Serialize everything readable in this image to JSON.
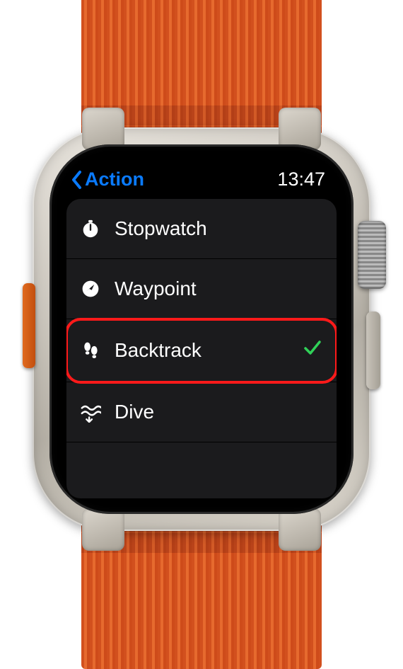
{
  "header": {
    "back_label": "Action",
    "time": "13:47"
  },
  "items": [
    {
      "id": "stopwatch",
      "label": "Stopwatch",
      "icon": "stopwatch-icon",
      "selected": false
    },
    {
      "id": "waypoint",
      "label": "Waypoint",
      "icon": "location-icon",
      "selected": false
    },
    {
      "id": "backtrack",
      "label": "Backtrack",
      "icon": "footprints-icon",
      "selected": true,
      "highlighted": true
    },
    {
      "id": "dive",
      "label": "Dive",
      "icon": "dive-icon",
      "selected": false
    }
  ],
  "colors": {
    "accent": "#0a7bff",
    "check": "#30d158",
    "callout": "#ff1a1a"
  }
}
